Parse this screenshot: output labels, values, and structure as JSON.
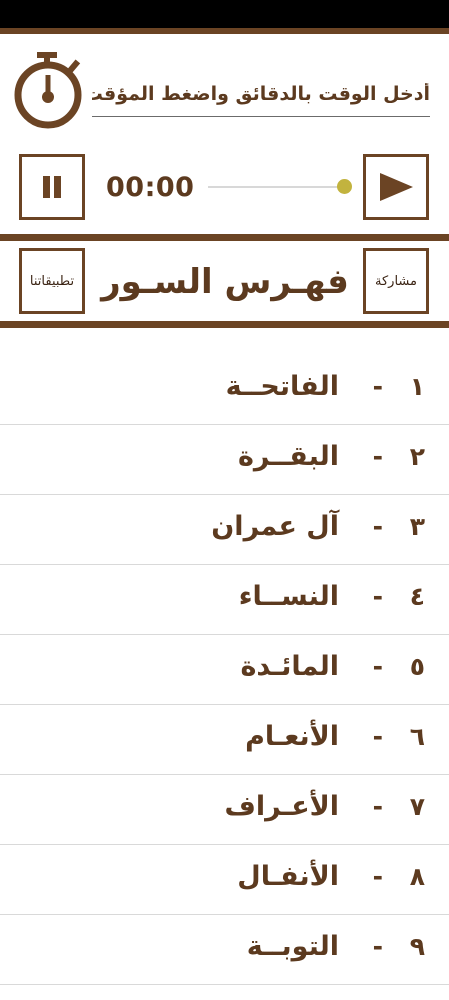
{
  "timer": {
    "input_placeholder": "أدخل الوقت بالدقائق واضغط المؤقت",
    "time_display": "00:00",
    "progress": 1.0,
    "thumb_color": "#c2b33e"
  },
  "header": {
    "title": "فهـرس السـور",
    "share_label": "مشاركة",
    "apps_label": "تطبيقاتنا"
  },
  "colors": {
    "brown": "#6b4424",
    "text_brown": "#5c3a1f",
    "divider": "#d9d9d9"
  },
  "surahs": [
    {
      "num": "١",
      "name": "الفاتحــة"
    },
    {
      "num": "٢",
      "name": "البقــرة"
    },
    {
      "num": "٣",
      "name": "آل عمران"
    },
    {
      "num": "٤",
      "name": "النســاء"
    },
    {
      "num": "٥",
      "name": "المائـدة"
    },
    {
      "num": "٦",
      "name": "الأنعـام"
    },
    {
      "num": "٧",
      "name": "الأعـراف"
    },
    {
      "num": "٨",
      "name": "الأنفـال"
    },
    {
      "num": "٩",
      "name": "التوبــة"
    }
  ],
  "separator": "-"
}
